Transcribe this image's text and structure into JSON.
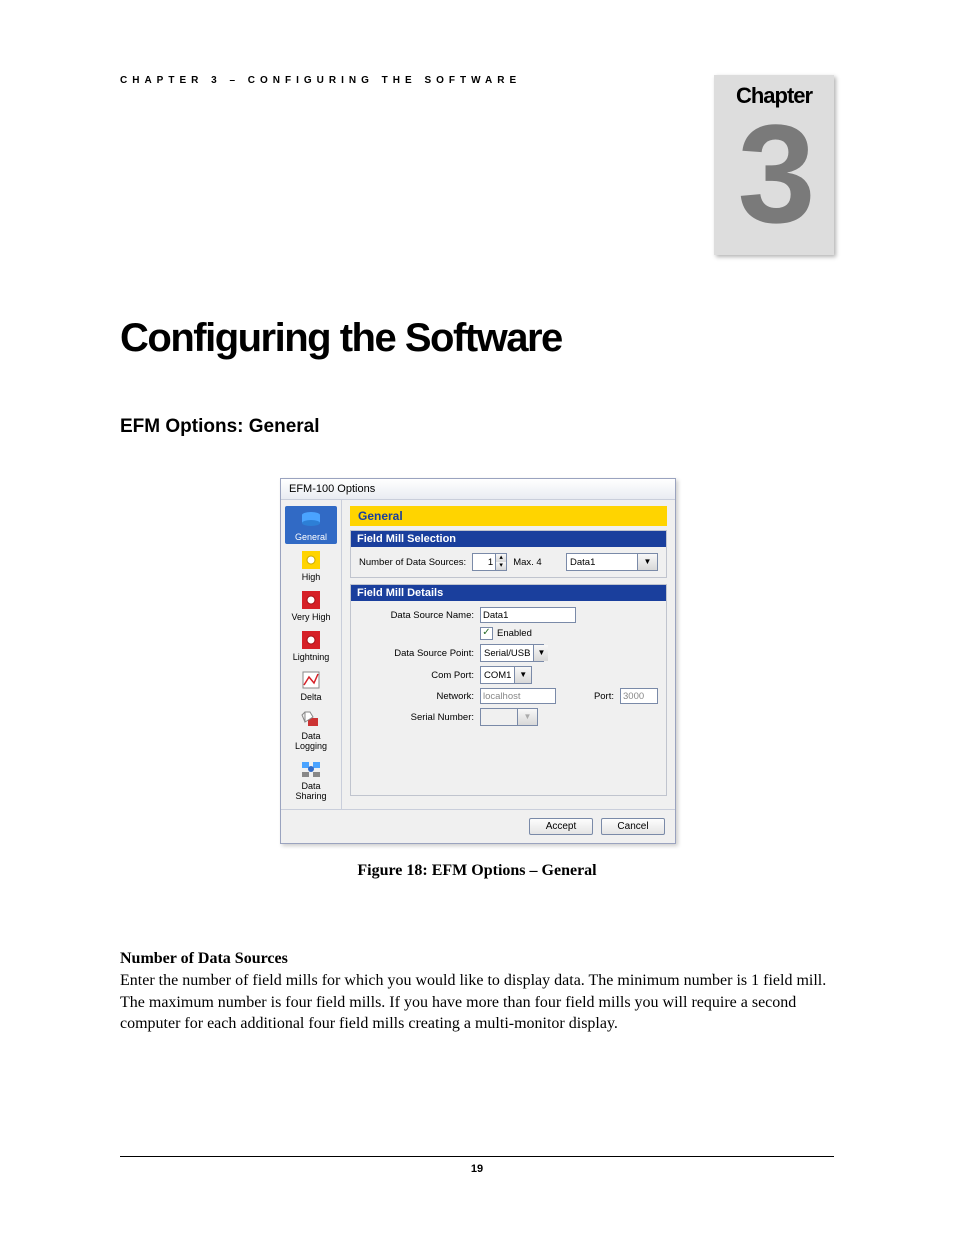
{
  "running_head": "CHAPTER 3 – CONFIGURING THE SOFTWARE",
  "chapter_badge": {
    "label": "Chapter",
    "number": "3"
  },
  "title": "Configuring the Software",
  "section": "EFM Options: General",
  "dialog": {
    "title": "EFM-100 Options",
    "sidebar": [
      {
        "label": "General",
        "icon_name": "general-icon"
      },
      {
        "label": "High",
        "icon_name": "high-icon"
      },
      {
        "label": "Very High",
        "icon_name": "veryhigh-icon"
      },
      {
        "label": "Lightning",
        "icon_name": "lightning-icon"
      },
      {
        "label": "Delta",
        "icon_name": "delta-icon"
      },
      {
        "label": "Data Logging",
        "icon_name": "datalogging-icon"
      },
      {
        "label": "Data Sharing",
        "icon_name": "datasharing-icon"
      }
    ],
    "main_title": "General",
    "group1": {
      "title": "Field Mill Selection",
      "num_label": "Number of Data Sources:",
      "num_value": "1",
      "max_label": "Max. 4",
      "selector_value": "Data1"
    },
    "group2": {
      "title": "Field Mill Details",
      "dsname_label": "Data Source Name:",
      "dsname_value": "Data1",
      "enabled_label": "Enabled",
      "dspoint_label": "Data Source Point:",
      "dspoint_value": "Serial/USB",
      "com_label": "Com Port:",
      "com_value": "COM1",
      "net_label": "Network:",
      "net_value": "localhost",
      "port_label": "Port:",
      "port_value": "3000",
      "serial_label": "Serial Number:",
      "serial_value": ""
    },
    "accept": "Accept",
    "cancel": "Cancel"
  },
  "caption": "Figure 18:  EFM Options – General",
  "para_head": "Number of Data Sources",
  "para_body": "Enter the number of field mills for which you would like to display data.  The minimum number is 1 field mill.  The maximum number is four field mills.  If you have more than four field mills you will require a second computer for each additional four field mills creating a multi-monitor display.",
  "page_number": "19"
}
